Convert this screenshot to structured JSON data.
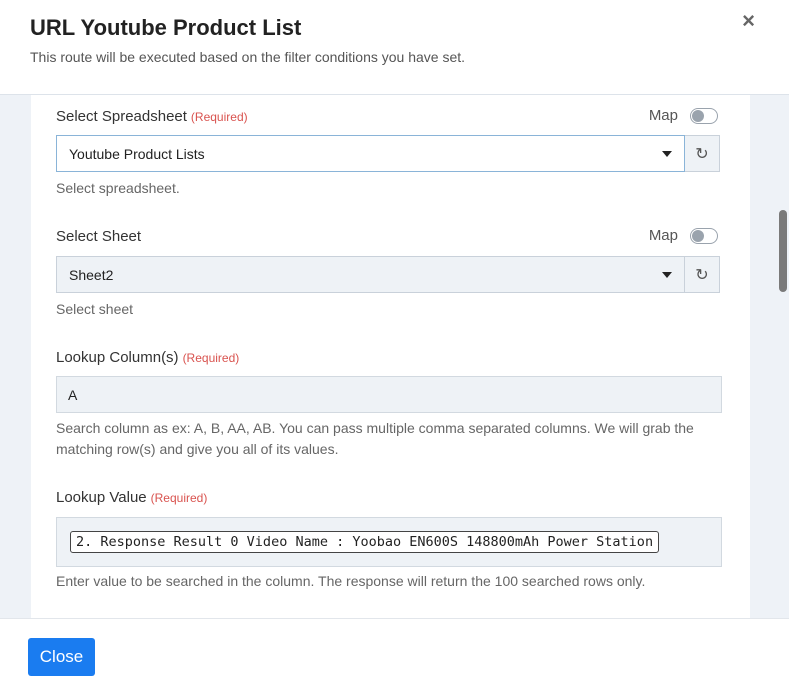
{
  "header": {
    "title": "URL Youtube Product List",
    "subtitle": "This route will be executed based on the filter conditions you have set.",
    "close_icon": "×"
  },
  "fields": {
    "spreadsheet": {
      "label": "Select Spreadsheet",
      "required": "(Required)",
      "map_label": "Map",
      "value": "Youtube Product Lists",
      "help": "Select spreadsheet."
    },
    "sheet": {
      "label": "Select Sheet",
      "map_label": "Map",
      "value": "Sheet2",
      "help": "Select sheet"
    },
    "lookup_column": {
      "label": "Lookup Column(s)",
      "required": "(Required)",
      "value": "A",
      "help": "Search column as ex: A, B, AA, AB. You can pass multiple comma separated columns. We will grab the matching row(s) and give you all of its values."
    },
    "lookup_value": {
      "label": "Lookup Value",
      "required": "(Required)",
      "chip": "2. Response Result 0 Video Name : Yoobao EN600S 148800mAh Power Station",
      "help": "Enter value to be searched in the column. The response will return the 100 searched rows only."
    }
  },
  "icons": {
    "refresh": "↻"
  },
  "footer": {
    "close_label": "Close"
  },
  "colors": {
    "primary": "#1a7cf0",
    "required": "#d9534f"
  }
}
